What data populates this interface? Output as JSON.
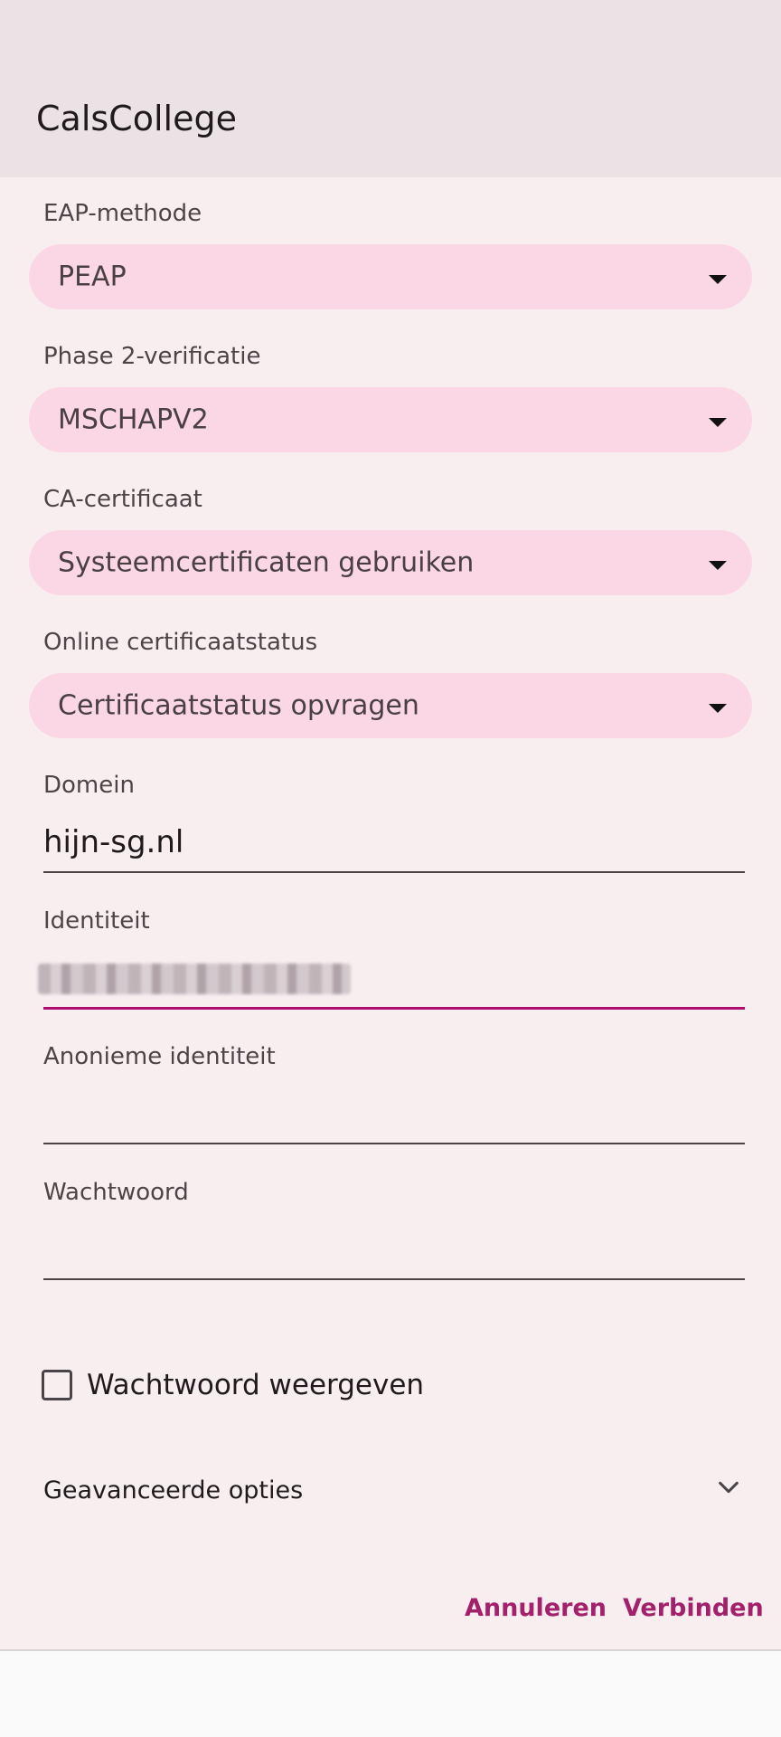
{
  "dialog": {
    "title": "CalsCollege"
  },
  "fields": {
    "eap_method": {
      "label": "EAP-methode",
      "value": "PEAP"
    },
    "phase2": {
      "label": "Phase 2-verificatie",
      "value": "MSCHAPV2"
    },
    "ca_cert": {
      "label": "CA-certificaat",
      "value": "Systeemcertificaten gebruiken"
    },
    "online_status": {
      "label": "Online certificaatstatus",
      "value": "Certificaatstatus opvragen"
    },
    "domain": {
      "label": "Domein",
      "value": "hijn-sg.nl"
    },
    "identity": {
      "label": "Identiteit",
      "value": ""
    },
    "anonymous_identity": {
      "label": "Anonieme identiteit",
      "value": ""
    },
    "password": {
      "label": "Wachtwoord",
      "value": ""
    }
  },
  "show_password": {
    "label": "Wachtwoord weergeven",
    "checked": false
  },
  "advanced": {
    "label": "Geavanceerde opties"
  },
  "actions": {
    "cancel_label": "Annuleren",
    "connect_label": "Verbinden"
  },
  "colors": {
    "accent": "#a3206b",
    "dropdown_bg": "#fbd7e5",
    "dialog_bg": "#f8eef0",
    "header_bg": "#ebe2e5"
  },
  "icons": {
    "dropdown": "caret-down-icon",
    "advanced": "chevron-down-icon"
  }
}
